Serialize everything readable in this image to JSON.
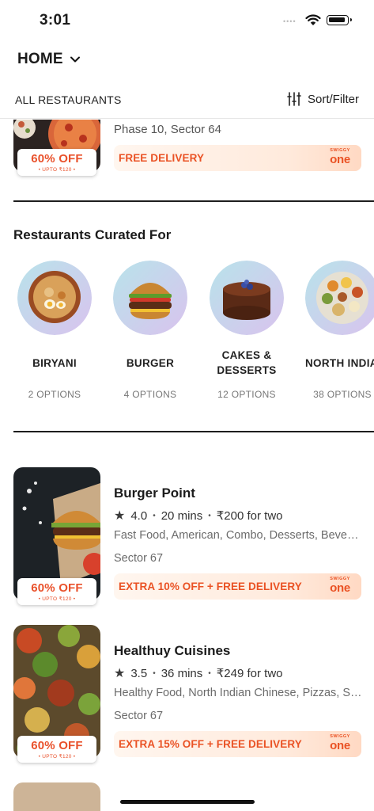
{
  "status_bar": {
    "time": "3:01",
    "dots": "••••"
  },
  "header": {
    "location": "HOME"
  },
  "filter_bar": {
    "all_restaurants": "ALL RESTAURANTS",
    "sort_filter": "Sort/Filter"
  },
  "partial_card": {
    "area": "Phase 10, Sector 64",
    "offer": "60% OFF",
    "offer_sub": "• UPTO ₹120 •",
    "delivery": "FREE DELIVERY"
  },
  "curated": {
    "title": "Restaurants Curated For",
    "categories": [
      {
        "name": "BIRYANI",
        "options": "2 OPTIONS"
      },
      {
        "name": "BURGER",
        "options": "4 OPTIONS"
      },
      {
        "name": "CAKES &",
        "name2": "DESSERTS",
        "options": "12 OPTIONS"
      },
      {
        "name": "NORTH INDIA",
        "options": "38 OPTIONS"
      }
    ]
  },
  "restaurants": [
    {
      "name": "Burger Point",
      "rating": "4.0",
      "time": "20 mins",
      "price": "₹200 for two",
      "cuisines": "Fast Food, American, Combo, Desserts, Beverages",
      "area": "Sector 67",
      "offer": "60% OFF",
      "offer_sub": "• UPTO ₹120 •",
      "delivery": "EXTRA 10% OFF + FREE DELIVERY"
    },
    {
      "name": "Healthuy Cuisines",
      "rating": "3.5",
      "time": "36 mins",
      "price": "₹249 for two",
      "cuisines": "Healthy Food, North Indian Chinese, Pizzas, Salads",
      "area": "Sector 67",
      "offer": "60% OFF",
      "offer_sub": "• UPTO ₹120 •",
      "delivery": "EXTRA 15% OFF + FREE DELIVERY"
    }
  ],
  "swiggy_one": {
    "small": "SWIGGY",
    "big": "one"
  },
  "colors": {
    "accent": "#ea5224",
    "offer": "#e9512b"
  }
}
